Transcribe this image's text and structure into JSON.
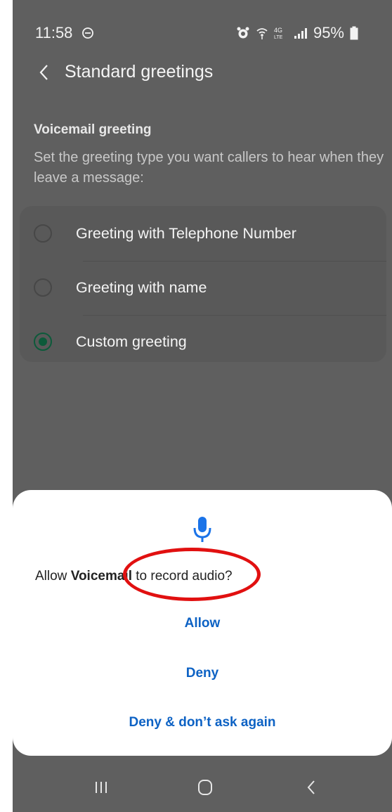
{
  "status_bar": {
    "time": "11:58",
    "battery": "95%",
    "icons": [
      "do-not-disturb-icon",
      "alarm-icon",
      "wifi-icon",
      "4g-lte-icon",
      "signal-icon",
      "battery-icon"
    ]
  },
  "header": {
    "title": "Standard greetings",
    "back_icon": "chevron-left-icon"
  },
  "section": {
    "title": "Voicemail greeting",
    "description": "Set the greeting type you want callers to hear when they leave a message:"
  },
  "options": [
    {
      "label": "Greeting with Telephone Number",
      "selected": false
    },
    {
      "label": "Greeting with name",
      "selected": false
    },
    {
      "label": "Custom greeting",
      "selected": true
    }
  ],
  "dialog": {
    "icon": "microphone-icon",
    "message_prefix": "Allow ",
    "app_name": "Voicemail",
    "message_suffix": " to record audio?",
    "buttons": [
      "Allow",
      "Deny",
      "Deny & don’t ask again"
    ]
  },
  "nav_bar": {
    "items": [
      "recents-icon",
      "home-icon",
      "back-icon"
    ]
  },
  "colors": {
    "accent": "#0d62c4",
    "selected_radio": "#0c5a3a",
    "annotation": "#e11010",
    "dim_background": "#5f5f5f"
  }
}
